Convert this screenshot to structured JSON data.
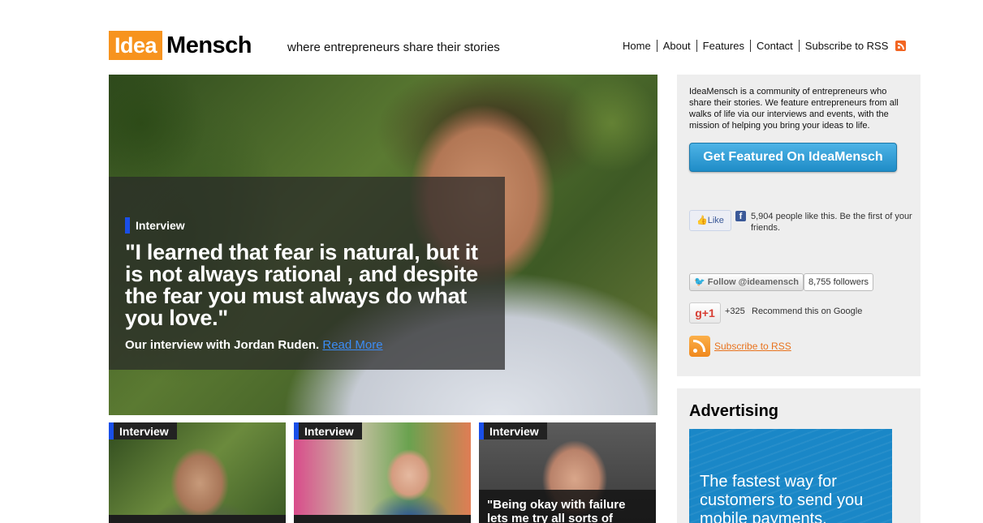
{
  "header": {
    "logo_part1": "Idea",
    "logo_part2": "Mensch",
    "tagline": "where entrepreneurs share their stories",
    "nav": [
      "Home",
      "About",
      "Features",
      "Contact",
      "Subscribe to RSS"
    ]
  },
  "hero": {
    "tag": "Interview",
    "quote": "\"I learned that fear is natural, but it is not always rational , and despite the fear you must always do what you love.\"",
    "subtitle": "Our interview with Jordan Ruden.",
    "read_more": "Read More"
  },
  "thumbs": [
    {
      "tag": "Interview"
    },
    {
      "tag": "Interview"
    },
    {
      "tag": "Interview",
      "quote": "\"Being okay with failure lets me try all sorts of"
    }
  ],
  "sidebar": {
    "about": "IdeaMensch is a community of entrepreneurs who share their stories. We feature entrepreneurs from all walks of life via our interviews and events, with the mission of helping you bring your ideas to life.",
    "feature_button": "Get Featured On IdeaMensch",
    "like_button": "Like",
    "fb_text": "5,904 people like this. Be the first of your friends.",
    "twitter_button": "Follow @ideamensch",
    "twitter_count": "8,755 followers",
    "gplus_label": "+1",
    "gplus_count": "+325",
    "gplus_text": "Recommend this on Google",
    "rss_link": "Subscribe to RSS"
  },
  "advertising": {
    "title": "Advertising",
    "ad_text": "The fastest way for customers to send you mobile payments."
  },
  "colors": {
    "brand_orange": "#f7931e",
    "tag_blue": "#1a4fe8",
    "button_blue": "#2b9ad6",
    "link_blue": "#3b8cf5",
    "rss_orange": "#e8731e"
  }
}
